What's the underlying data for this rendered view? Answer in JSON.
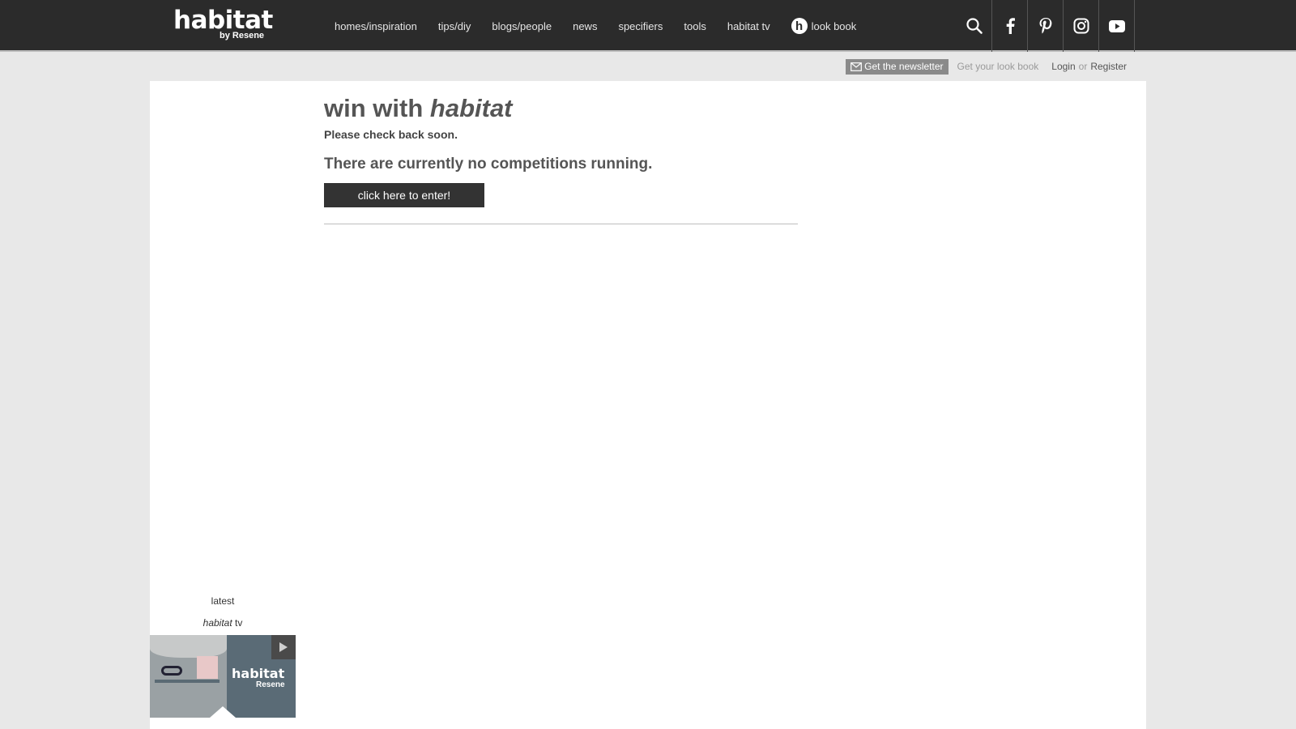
{
  "brand": {
    "name": "habitat",
    "sub": "by Resene"
  },
  "nav": {
    "items": [
      {
        "label": "homes/inspiration"
      },
      {
        "label": "tips/diy"
      },
      {
        "label": "blogs/people"
      },
      {
        "label": "news"
      },
      {
        "label": "specifiers"
      },
      {
        "label": "tools"
      },
      {
        "label": "habitat tv"
      }
    ],
    "lookbook": {
      "glyph": "h",
      "label": "look book"
    }
  },
  "social": [
    "search-icon",
    "facebook-icon",
    "pinterest-icon",
    "instagram-icon",
    "youtube-icon"
  ],
  "subbar": {
    "newsletter": "Get the newsletter",
    "lookbook": "Get your look book",
    "login": "Login",
    "or": "or",
    "register": "Register"
  },
  "main": {
    "title_plain": "win with",
    "title_italic": "habitat",
    "check_back": "Please check back soon.",
    "no_competitions": "There are currently no competitions running.",
    "enter_button": "click here to enter!"
  },
  "sidebar": {
    "latest": "latest",
    "tv_italic": "habitat",
    "tv_plain": "tv",
    "thumb_logo": "habitat",
    "thumb_logo_sub": "Resene"
  },
  "colors": {
    "topbar": "#2b2b2b",
    "background": "#e8e8e8",
    "button": "#333333"
  }
}
